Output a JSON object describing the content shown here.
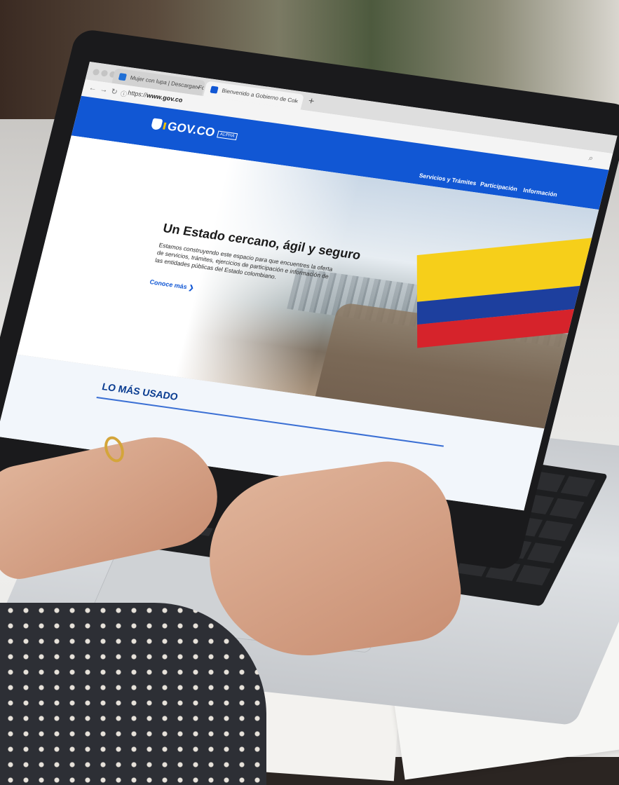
{
  "browser": {
    "tabs": [
      {
        "label": "Mujer con lupa | Descargar Fot",
        "favicon_color": "#1f6fd6"
      },
      {
        "label": "Bienvenido a Gobierno de Col",
        "favicon_color": "#1157d4"
      }
    ],
    "close_glyph": "×",
    "new_tab_glyph": "+",
    "url_prefix": "https://",
    "url_domain": "www.gov.co",
    "icons": [
      "back-icon",
      "forward-icon",
      "reload-icon",
      "info-icon",
      "zoom-icon"
    ]
  },
  "site": {
    "logo_text": "GOV.CO",
    "badge": "ALPHA",
    "menu": [
      "Servicios y Trámites",
      "Participación",
      "Información"
    ],
    "hero": {
      "title": "Un Estado cercano, ágil y seguro",
      "text": "Estamos construyendo este espacio para que encuentres la oferta de servicios, trámites, ejercicios de participación e información de las entidades públicas del Estado colombiano.",
      "link": "Conoce más"
    },
    "section_title": "LO MÁS USADO"
  },
  "colors": {
    "brand_blue": "#1157d4",
    "flag_yellow": "#f6cf1a",
    "flag_blue": "#1d3f9e",
    "flag_red": "#d6232b"
  }
}
